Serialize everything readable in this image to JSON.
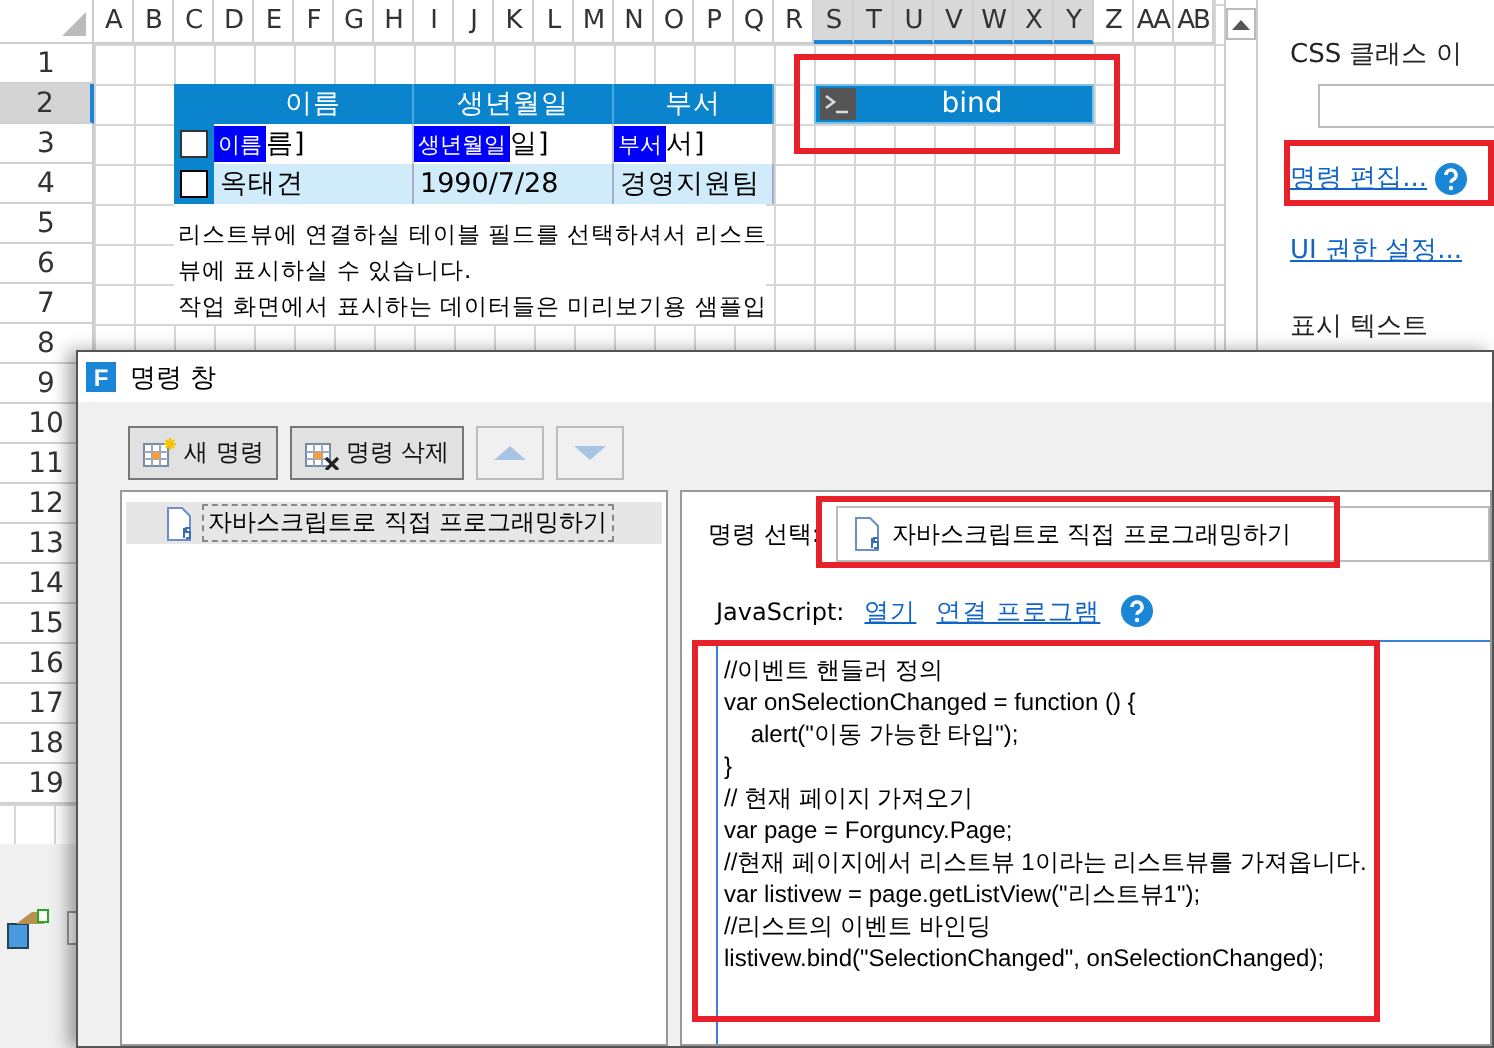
{
  "sheet": {
    "columns": [
      {
        "label": "A",
        "selected": false
      },
      {
        "label": "B",
        "selected": false
      },
      {
        "label": "C",
        "selected": false
      },
      {
        "label": "D",
        "selected": false
      },
      {
        "label": "E",
        "selected": false
      },
      {
        "label": "F",
        "selected": false
      },
      {
        "label": "G",
        "selected": false
      },
      {
        "label": "H",
        "selected": false
      },
      {
        "label": "I",
        "selected": false
      },
      {
        "label": "J",
        "selected": false
      },
      {
        "label": "K",
        "selected": false
      },
      {
        "label": "L",
        "selected": false
      },
      {
        "label": "M",
        "selected": false
      },
      {
        "label": "N",
        "selected": false
      },
      {
        "label": "O",
        "selected": false
      },
      {
        "label": "P",
        "selected": false
      },
      {
        "label": "Q",
        "selected": false
      },
      {
        "label": "R",
        "selected": false
      },
      {
        "label": "S",
        "selected": true
      },
      {
        "label": "T",
        "selected": true
      },
      {
        "label": "U",
        "selected": true
      },
      {
        "label": "V",
        "selected": true
      },
      {
        "label": "W",
        "selected": true
      },
      {
        "label": "X",
        "selected": true
      },
      {
        "label": "Y",
        "selected": true
      },
      {
        "label": "Z",
        "selected": false
      },
      {
        "label": "AA",
        "selected": false
      },
      {
        "label": "AB",
        "selected": false
      }
    ],
    "rows": [
      {
        "label": "1",
        "selected": false
      },
      {
        "label": "2",
        "selected": true
      },
      {
        "label": "3",
        "selected": false
      },
      {
        "label": "4",
        "selected": false
      },
      {
        "label": "5",
        "selected": false
      },
      {
        "label": "6",
        "selected": false
      },
      {
        "label": "7",
        "selected": false
      },
      {
        "label": "8",
        "selected": false
      },
      {
        "label": "9",
        "selected": false
      },
      {
        "label": "10",
        "selected": false
      },
      {
        "label": "11",
        "selected": false
      },
      {
        "label": "12",
        "selected": false
      },
      {
        "label": "13",
        "selected": false
      },
      {
        "label": "14",
        "selected": false
      },
      {
        "label": "15",
        "selected": false
      },
      {
        "label": "16",
        "selected": false
      },
      {
        "label": "17",
        "selected": false
      },
      {
        "label": "18",
        "selected": false
      },
      {
        "label": "19",
        "selected": false
      }
    ],
    "listview": {
      "headers": [
        "이름",
        "생년월일",
        "부서"
      ],
      "template_row": {
        "checked": false,
        "cells": [
          {
            "tag": "이름",
            "text": "름]"
          },
          {
            "tag": "생년월일",
            "text": "일]"
          },
          {
            "tag": "부서",
            "text": "서]"
          }
        ]
      },
      "rows": [
        {
          "checked": false,
          "cells": [
            "옥태견",
            "1990/7/28",
            "경영지원팀"
          ]
        }
      ]
    },
    "note_lines": [
      "리스트뷰에 연결하실 테이블 필드를 선택하셔서 리스트",
      "뷰에 표시하실 수 있습니다.",
      "작업 화면에서 표시하는 데이터들은 미리보기용 샘플입"
    ],
    "button": {
      "label": "bind",
      "highlighted": true
    }
  },
  "properties": {
    "css_class_label": "CSS 클래스 이",
    "command_link": {
      "label": "명령 편집...",
      "highlighted": true
    },
    "permission_link": "UI 권한 설정...",
    "display_text_label": "표시 텍스트"
  },
  "dialog": {
    "icon_letter": "F",
    "title": "명령 창",
    "toolbar": [
      {
        "kind": "new",
        "label": "새 명령",
        "disabled": false
      },
      {
        "kind": "delete",
        "label": "명령 삭제",
        "disabled": false
      },
      {
        "kind": "up",
        "disabled": true
      },
      {
        "kind": "down",
        "disabled": true
      }
    ],
    "commands": [
      {
        "label": "자바스크립트로 직접 프로그래밍하기",
        "selected": true
      }
    ],
    "command_select": {
      "label": "명령 선택:",
      "value": "자바스크립트로 직접 프로그래밍하기",
      "highlighted": true
    },
    "script": {
      "label": "JavaScript:",
      "links": [
        "열기",
        "연결 프로그램"
      ],
      "highlighted": true,
      "code": [
        "//이벤트 핸들러 정의",
        "var onSelectionChanged = function () {",
        "    alert(\"이동 가능한 타입\");",
        "}",
        "// 현재 페이지 가져오기",
        "var page = Forguncy.Page;",
        "//현재 페이지에서 리스트뷰 1이라는 리스트뷰를 가져옵니다.",
        "var listivew = page.getListView(\"리스트뷰1\");",
        "//리스트의 이벤트 바인딩",
        "listivew.bind(\"SelectionChanged\", onSelectionChanged);"
      ]
    }
  }
}
